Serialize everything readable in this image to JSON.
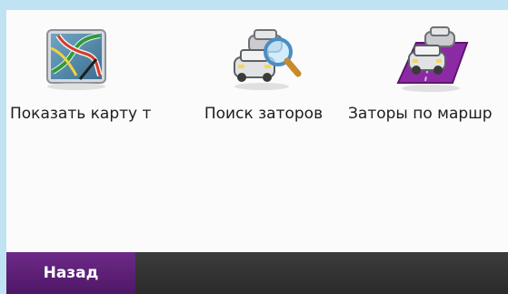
{
  "menu": {
    "items": [
      {
        "label": "Показать карту т",
        "icon": "traffic-map-icon"
      },
      {
        "label": "Поиск заторов",
        "icon": "search-traffic-icon"
      },
      {
        "label": "Заторы по маршр",
        "icon": "route-traffic-icon"
      }
    ]
  },
  "footer": {
    "back_label": "Назад"
  },
  "colors": {
    "background": "#bfe3f3",
    "panel": "#fbfbfb",
    "bottom_bar": "#333333",
    "back_button": "#5e1f79"
  }
}
